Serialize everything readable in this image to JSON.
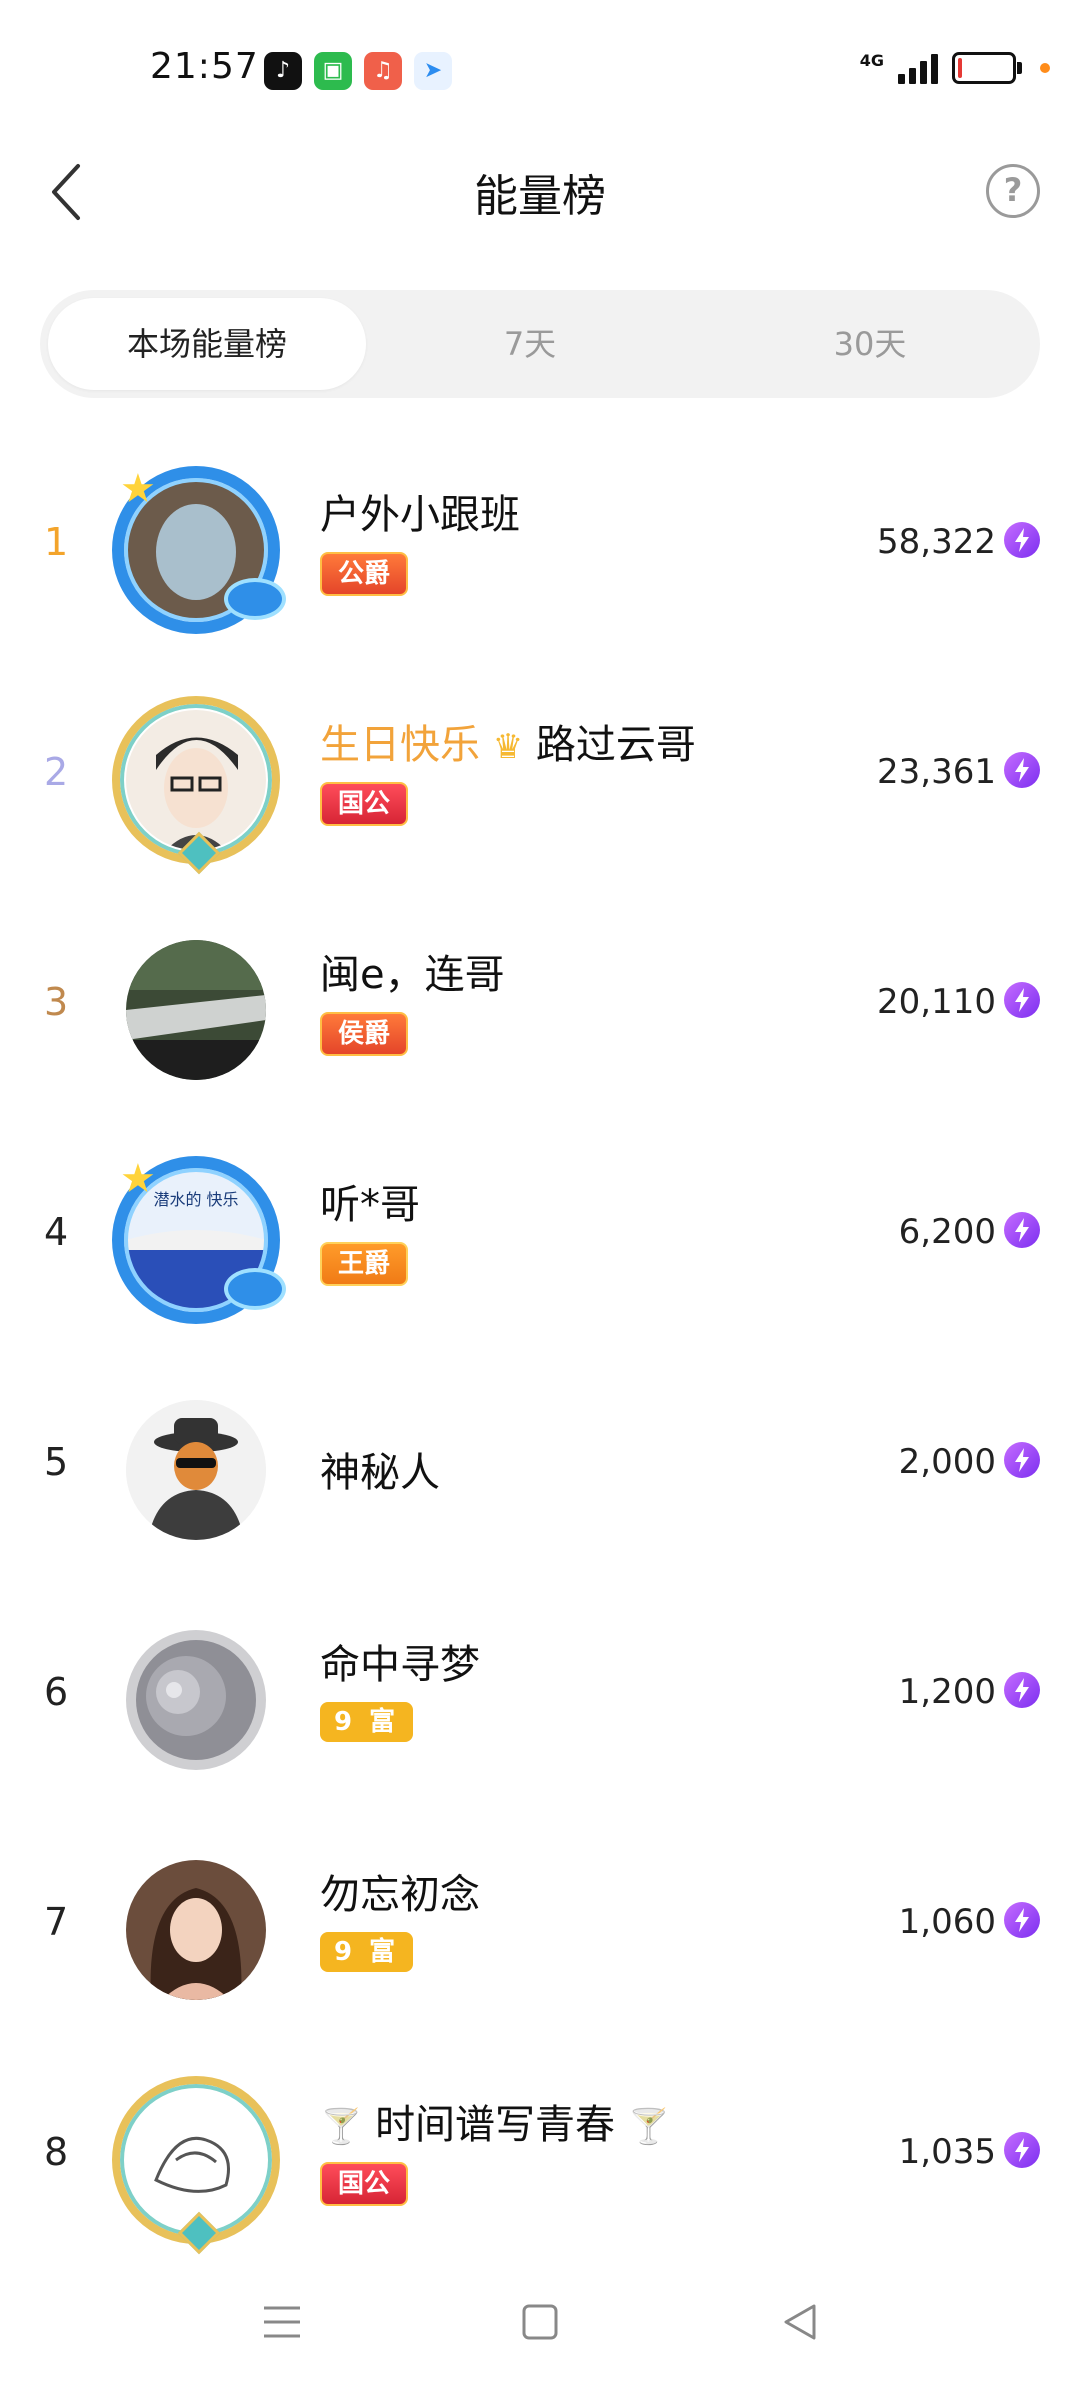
{
  "status_bar": {
    "time": "21:57",
    "apps": [
      "tiktok-icon",
      "shop-icon",
      "music-icon",
      "plane-icon"
    ],
    "network": "4G",
    "accent_dot_color": "#ff8c1a"
  },
  "header": {
    "title": "能量榜",
    "back_icon": "chevron-left-icon",
    "help_icon": "help-icon",
    "help_symbol": "?"
  },
  "tabs": [
    {
      "label": "本场能量榜",
      "active": true
    },
    {
      "label": "7天",
      "active": false
    },
    {
      "label": "30天",
      "active": false
    }
  ],
  "ranking": [
    {
      "rank": "1",
      "rank_color": "#f3a42b",
      "name_prefix": "",
      "name": "户外小跟班",
      "badge": "公爵",
      "score": "58,322"
    },
    {
      "rank": "2",
      "rank_color": "#a9a9e6",
      "name_prefix": "生日快乐",
      "name": "路过云哥",
      "badge": "国公",
      "score": "23,361"
    },
    {
      "rank": "3",
      "rank_color": "#c0894e",
      "name_prefix": "",
      "name": "闽e，连哥",
      "badge": "侯爵",
      "score": "20,110"
    },
    {
      "rank": "4",
      "rank_color": "#222222",
      "name_prefix": "",
      "name": "听*哥",
      "badge": "王爵",
      "score": "6,200",
      "avatar_text": "潜水的 快乐"
    },
    {
      "rank": "5",
      "rank_color": "#222222",
      "name_prefix": "",
      "name": "神秘人",
      "badge": "",
      "score": "2,000"
    },
    {
      "rank": "6",
      "rank_color": "#222222",
      "name_prefix": "",
      "name": "命中寻梦",
      "badge": "9 富",
      "score": "1,200"
    },
    {
      "rank": "7",
      "rank_color": "#222222",
      "name_prefix": "",
      "name": "勿忘初念",
      "badge": "9 富",
      "score": "1,060"
    },
    {
      "rank": "8",
      "rank_color": "#222222",
      "name_prefix": "🍸",
      "name": "时间谱写青春",
      "name_suffix": "🍸",
      "badge": "国公",
      "score": "1,035"
    }
  ],
  "nav_bar": {
    "items": [
      "menu-icon",
      "home-square-icon",
      "back-triangle-icon"
    ]
  }
}
